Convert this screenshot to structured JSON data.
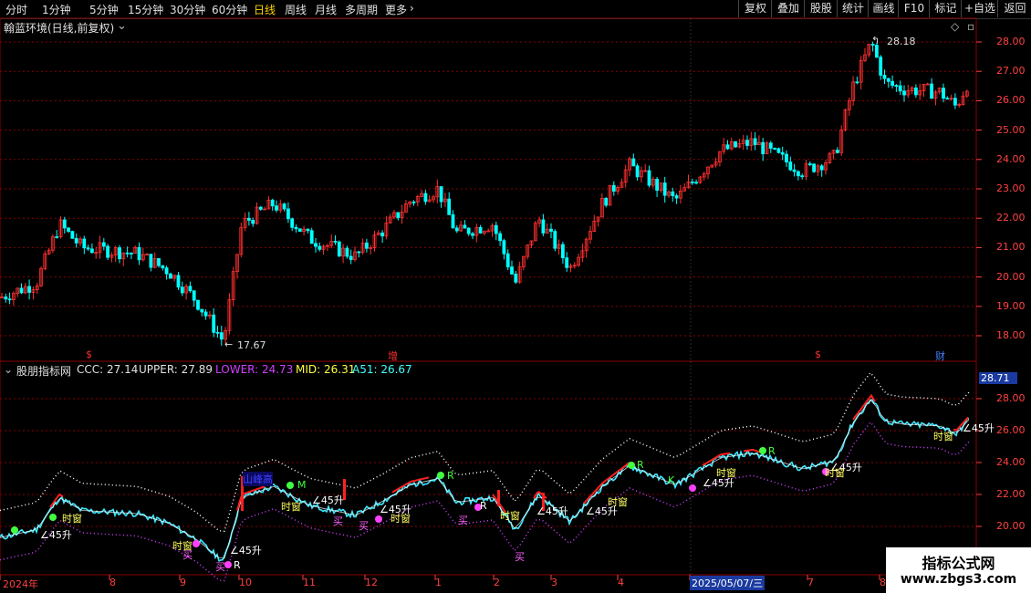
{
  "toolbar": {
    "periods": [
      "分时",
      "1分钟",
      "5分钟",
      "15分钟",
      "30分钟",
      "60分钟",
      "日线",
      "周线",
      "月线",
      "多周期",
      "更多"
    ],
    "active": "日线",
    "buttons": [
      "复权",
      "叠加",
      "股股",
      "统计",
      "画线",
      "F10",
      "标记",
      "+自选",
      "返回"
    ]
  },
  "main_panel": {
    "title": "翰蓝环境(日线,前复权)",
    "price_axis": [
      "28.00",
      "27.00",
      "26.00",
      "25.00",
      "24.00",
      "23.00",
      "22.00",
      "21.00",
      "20.00",
      "19.00",
      "18.00"
    ],
    "high_label": "28.18",
    "low_label": "17.67",
    "events": [
      "$",
      "增",
      "$",
      "财"
    ]
  },
  "indicator_panel": {
    "name": "股朋指标网",
    "ccc_label": "CCC: 27.14",
    "upper_label": "UPPER: 27.89",
    "lower_label": "LOWER: 24.73",
    "mid_label": "MID: 26.31",
    "a51_label": "A51: 26.67",
    "axis": [
      "28.00",
      "26.00",
      "24.00",
      "22.00",
      "20.00"
    ],
    "axis_current": "28.71",
    "markers": [
      "∠45升",
      "时窗",
      "买",
      "R",
      "K",
      "M",
      "山峰高"
    ]
  },
  "time_axis": {
    "labels": [
      "2024年",
      "8",
      "9",
      "10",
      "11",
      "12",
      "1",
      "2",
      "3",
      "4",
      "2025/05/07/三",
      "7",
      "8"
    ]
  },
  "watermark": {
    "line1": "指标公式网",
    "line2": "www.zbgs3.com"
  },
  "colors": {
    "up": "#ff3030",
    "down": "#00ffff",
    "grid": "#8b0000",
    "upper": "#ffffff",
    "lower": "#d040ff",
    "marker": "#ffff60"
  }
}
